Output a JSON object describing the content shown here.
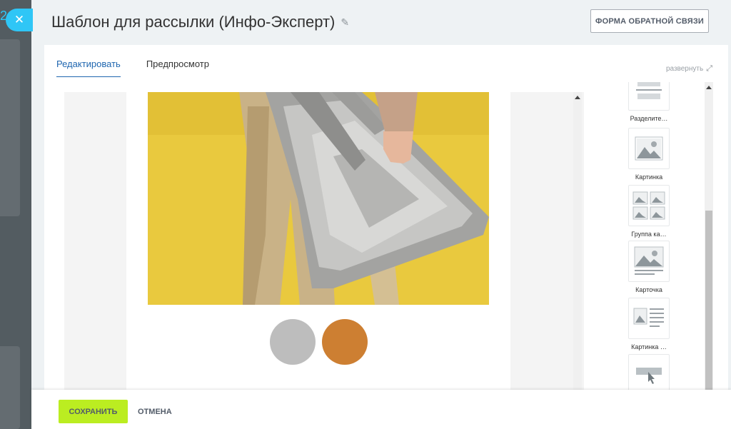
{
  "window": {
    "title": "Шаблон для рассылки (Инфо-Эксперт)",
    "background_digit": "2"
  },
  "header": {
    "feedback_button": "ФОРМА ОБРАТНОЙ СВЯЗИ"
  },
  "tabs": [
    {
      "label": "Редактировать",
      "active": true
    },
    {
      "label": "Предпросмотр",
      "active": false
    }
  ],
  "expand_label": "развернуть",
  "email_preview": {
    "image": "fashion-photo-silver-puffer-bag",
    "swatches": [
      {
        "name": "gray",
        "color": "#bdbdbd"
      },
      {
        "name": "orange",
        "color": "#cd7f32"
      }
    ]
  },
  "blocks": [
    {
      "label": "Разделите…",
      "icon": "divider-icon"
    },
    {
      "label": "Картинка",
      "icon": "image-icon"
    },
    {
      "label": "Группа ка…",
      "icon": "image-group-icon"
    },
    {
      "label": "Карточка",
      "icon": "card-icon"
    },
    {
      "label": "Картинка …",
      "icon": "image-text-icon"
    },
    {
      "label": "",
      "icon": "button-block-icon"
    }
  ],
  "footer": {
    "save": "СОХРАНИТЬ",
    "cancel": "ОТМЕНА"
  },
  "colors": {
    "accent_blue": "#2067b0",
    "close_button": "#2fc6f6",
    "save_button": "#bbed21"
  }
}
